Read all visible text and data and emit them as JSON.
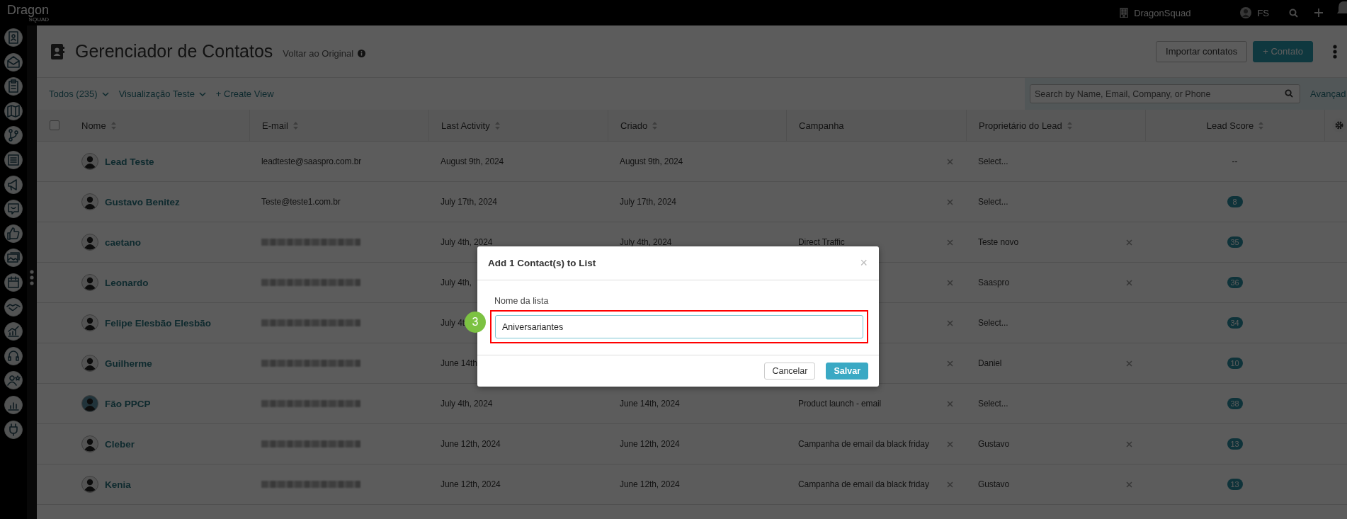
{
  "top_bar": {
    "logo": "Dragon",
    "logo_sub": "SQUAD",
    "account": "DragonSquad",
    "user": "FS"
  },
  "header": {
    "title": "Gerenciador de Contatos",
    "back_link": "Voltar ao Original",
    "buttons": [
      {
        "label": "Importar contatos",
        "kind": "secondary"
      },
      {
        "label": "+ Contato",
        "kind": "primary"
      }
    ]
  },
  "filters": [
    {
      "label": "Todos (235)",
      "dropdown": true
    },
    {
      "label": "Visualização Teste",
      "dropdown": true
    },
    {
      "label": "+ Create View",
      "dropdown": false
    }
  ],
  "search": {
    "placeholder": "Search by Name, Email, Company, or Phone"
  },
  "advanced_link": "Avançad",
  "table": {
    "columns": [
      {
        "label": "Nome",
        "sortable": true
      },
      {
        "label": "E-mail",
        "sortable": true
      },
      {
        "label": "Last Activity",
        "sortable": true
      },
      {
        "label": "Criado",
        "sortable": true
      },
      {
        "label": "Campanha",
        "sortable": false
      },
      {
        "label": "Proprietário do Lead",
        "sortable": true
      },
      {
        "label": "Lead Score",
        "sortable": true
      }
    ],
    "select_all_checked": false,
    "rows": [
      {
        "name": "Lead Teste",
        "avatar_photo": false,
        "email": "leadteste@saaspro.com.br",
        "email_blurred": false,
        "last_activity": "August 9th, 2024",
        "created": "August 9th, 2024",
        "owner": "Select...",
        "owner_clearable": false,
        "score": "--",
        "score_badge": false
      },
      {
        "name": "Gustavo Benitez",
        "avatar_photo": false,
        "email": "Teste@teste1.com.br",
        "email_blurred": false,
        "last_activity": "July 17th, 2024",
        "created": "July 17th, 2024",
        "owner": "Select...",
        "owner_clearable": false,
        "score": "8",
        "score_badge": true
      },
      {
        "name": "caetano",
        "avatar_photo": false,
        "email_blurred": true,
        "last_activity": "July 4th, 2024",
        "created": "July 4th, 2024",
        "campaign": "Direct Traffic",
        "owner": "Teste novo",
        "owner_clearable": true,
        "score": "35",
        "score_badge": true
      },
      {
        "name": "Leonardo",
        "avatar_photo": false,
        "email_blurred": true,
        "last_activity": "July 4th,",
        "owner": "Saaspro",
        "owner_clearable": true,
        "score": "36",
        "score_badge": true
      },
      {
        "name": "Felipe Elesbão Elesbão",
        "avatar_photo": false,
        "email_blurred": true,
        "last_activity": "July 4t",
        "owner": "Select...",
        "owner_clearable": false,
        "score": "34",
        "score_badge": true
      },
      {
        "name": "Guilherme",
        "avatar_photo": false,
        "email_blurred": true,
        "last_activity": "June 14th",
        "owner": "Daniel",
        "owner_clearable": true,
        "score": "10",
        "score_badge": true
      },
      {
        "name": "Fão PPCP",
        "avatar_photo": true,
        "email_blurred": true,
        "last_activity": "July 4th, 2024",
        "created": "June 14th, 2024",
        "campaign": "Product launch - email",
        "owner": "Select...",
        "owner_clearable": false,
        "score": "38",
        "score_badge": true
      },
      {
        "name": "Cleber",
        "avatar_photo": false,
        "email_blurred": true,
        "last_activity": "June 12th, 2024",
        "created": "June 12th, 2024",
        "campaign": "Campanha de email da black friday",
        "owner": "Gustavo",
        "owner_clearable": true,
        "score": "13",
        "score_badge": true
      },
      {
        "name": "Kenia",
        "avatar_photo": false,
        "email_blurred": true,
        "last_activity": "June 12th, 2024",
        "created": "June 12th, 2024",
        "campaign": "Campanha de email da black friday",
        "owner": "Gustavo",
        "owner_clearable": true,
        "score": "13",
        "score_badge": true
      }
    ]
  },
  "modal": {
    "title": "Add 1 Contact(s) to List",
    "close": "×",
    "field_label": "Nome da lista",
    "field_value": "Aniversariantes",
    "highlighted": true,
    "step_marker": "3",
    "buttons": [
      {
        "label": "Cancelar",
        "kind": "secondary"
      },
      {
        "label": "Salvar",
        "kind": "primary"
      }
    ]
  }
}
